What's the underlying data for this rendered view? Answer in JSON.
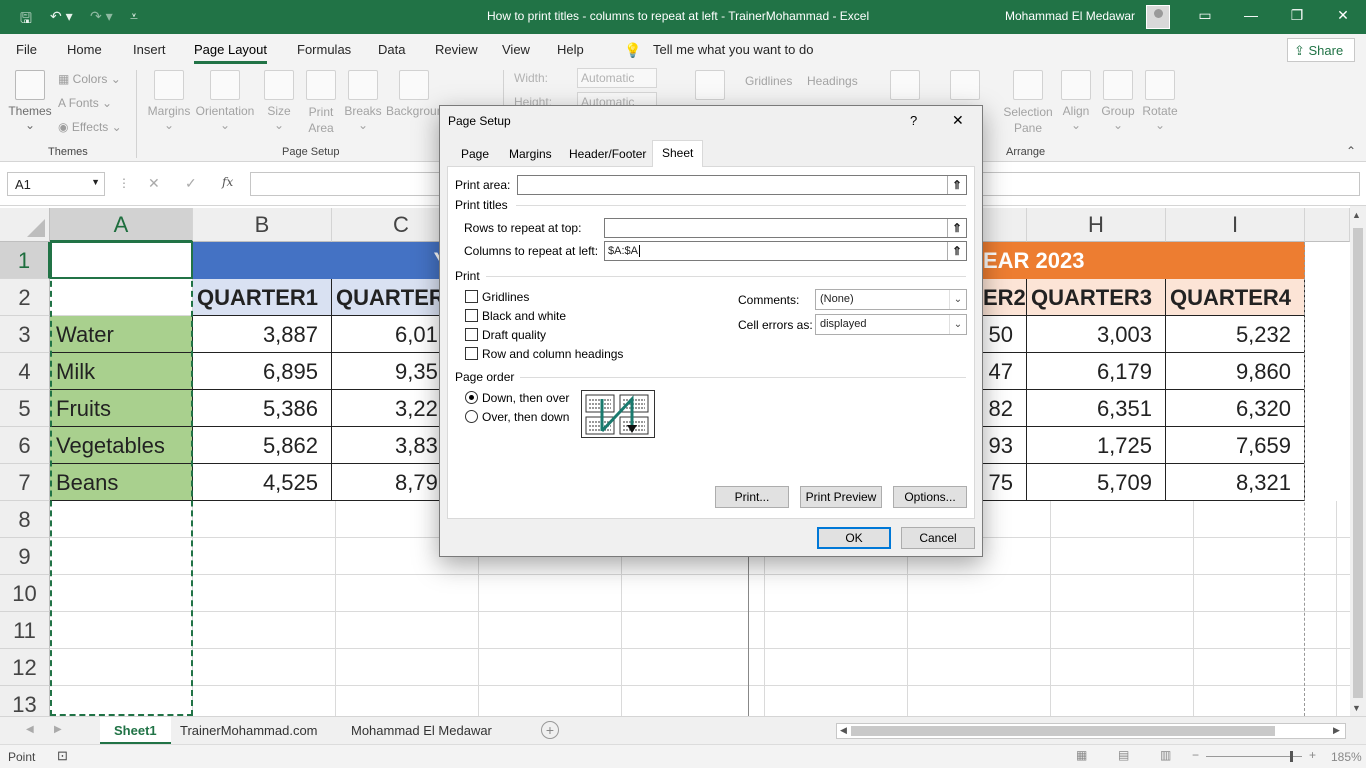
{
  "window": {
    "title": "How to print titles - columns to repeat at left - TrainerMohammad  -  Excel",
    "user": "Mohammad El Medawar"
  },
  "menu": [
    "File",
    "Home",
    "Insert",
    "Page Layout",
    "Formulas",
    "Data",
    "Review",
    "View",
    "Help"
  ],
  "tell_me": "Tell me what you want to do",
  "share": "Share",
  "ribbon": {
    "themes": "Themes",
    "colors": "Colors",
    "fonts": "Fonts",
    "effects": "Effects",
    "themes_group": "Themes",
    "margins": "Margins",
    "orientation": "Orientation",
    "size": "Size",
    "print_area": "Print Area",
    "breaks": "Breaks",
    "background": "Backgroun",
    "page_setup_group": "Page Setup",
    "width_label": "Width:",
    "width_value": "Automatic",
    "height_label": "Height:",
    "height_value": "Automatic",
    "gridlines": "Gridlines",
    "headings": "Headings",
    "view": "View",
    "selection_pane": "Selection Pane",
    "align": "Align",
    "group": "Group",
    "rotate": "Rotate",
    "arrange_group": "Arrange"
  },
  "formula_bar": {
    "name_box": "A1",
    "fx": "fx"
  },
  "grid": {
    "col_headers": [
      "A",
      "B",
      "C",
      "H",
      "I"
    ],
    "row_headers": [
      "1",
      "2",
      "3",
      "4",
      "5",
      "6",
      "7",
      "8",
      "9",
      "10",
      "11",
      "12",
      "13"
    ],
    "banner_left": "YE",
    "banner_right": "EAR 2023",
    "quarter_headers": {
      "b": "QUARTER1",
      "c": "QUARTER",
      "g": "ER2",
      "h": "QUARTER3",
      "i": "QUARTER4"
    },
    "rows": [
      {
        "label": "Water",
        "b": "3,887",
        "c": "6,01",
        "g": "50",
        "h": "3,003",
        "i": "5,232"
      },
      {
        "label": "Milk",
        "b": "6,895",
        "c": "9,35",
        "g": "47",
        "h": "6,179",
        "i": "9,860"
      },
      {
        "label": "Fruits",
        "b": "5,386",
        "c": "3,22",
        "g": "82",
        "h": "6,351",
        "i": "6,320"
      },
      {
        "label": "Vegetables",
        "b": "5,862",
        "c": "3,83",
        "g": "93",
        "h": "1,725",
        "i": "7,659"
      },
      {
        "label": "Beans",
        "b": "4,525",
        "c": "8,79",
        "g": "75",
        "h": "5,709",
        "i": "8,321"
      }
    ]
  },
  "sheets": [
    "Sheet1",
    "TrainerMohammad.com",
    "Mohammad El Medawar"
  ],
  "status": {
    "mode": "Point",
    "zoom": "185%"
  },
  "dialog": {
    "title": "Page Setup",
    "help": "?",
    "close": "✕",
    "tabs": [
      "Page",
      "Margins",
      "Header/Footer",
      "Sheet"
    ],
    "print_area_label": "Print area:",
    "print_area_value": "",
    "print_titles_label": "Print titles",
    "rows_top_label": "Rows to repeat at top:",
    "rows_top_value": "",
    "cols_left_label": "Columns to repeat at left:",
    "cols_left_value": "$A:$A",
    "print_label": "Print",
    "checks": [
      "Gridlines",
      "Black and white",
      "Draft quality",
      "Row and column headings"
    ],
    "comments_label": "Comments:",
    "comments_value": "(None)",
    "cell_errors_label": "Cell errors as:",
    "cell_errors_value": "displayed",
    "page_order_label": "Page order",
    "order_options": [
      "Down, then over",
      "Over, then down"
    ],
    "buttons": {
      "print": "Print...",
      "preview": "Print Preview",
      "options": "Options...",
      "ok": "OK",
      "cancel": "Cancel"
    }
  },
  "colors": {
    "excel_green": "#217346",
    "banner_blue": "#4472c4",
    "banner_orange": "#ed7d31",
    "label_green": "#a9d08e",
    "header_blue": "#d9e1f2",
    "header_orange": "#fce4d6"
  }
}
